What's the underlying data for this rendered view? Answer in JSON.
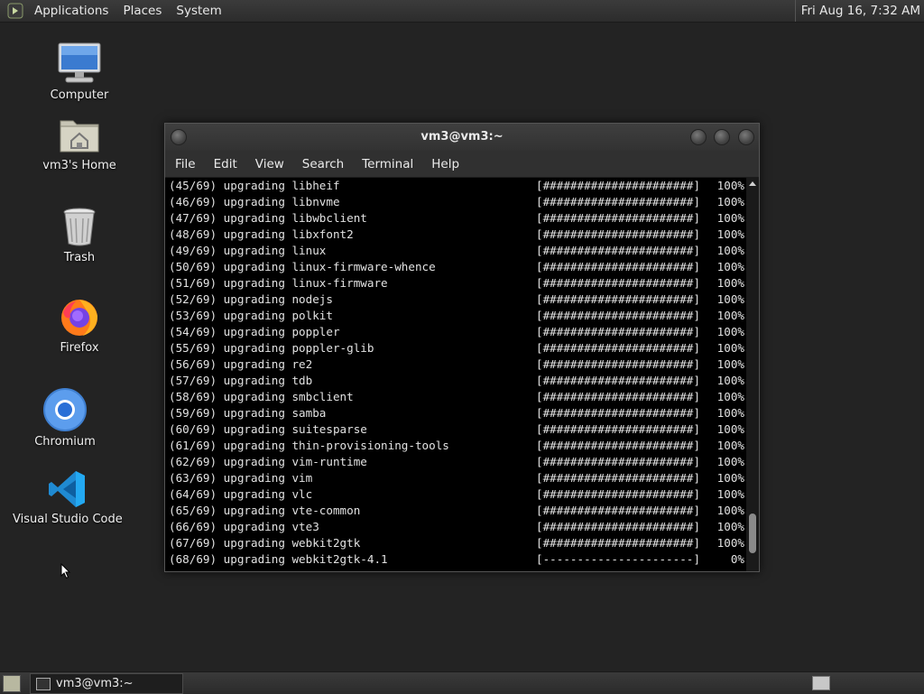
{
  "top_panel": {
    "menus": [
      "Applications",
      "Places",
      "System"
    ],
    "clock": "Fri Aug 16, 7:32 AM"
  },
  "desktop": {
    "icons": [
      {
        "label": "Computer",
        "icon": "computer-icon"
      },
      {
        "label": "vm3's Home",
        "icon": "home-folder-icon"
      },
      {
        "label": "Trash",
        "icon": "trash-icon"
      },
      {
        "label": "Firefox",
        "icon": "firefox-icon"
      },
      {
        "label": "Chromium",
        "icon": "chromium-icon"
      },
      {
        "label": "Visual Studio Code",
        "icon": "vscode-icon"
      }
    ]
  },
  "window": {
    "title": "vm3@vm3:~",
    "menus": [
      "File",
      "Edit",
      "View",
      "Search",
      "Terminal",
      "Help"
    ],
    "lines": [
      {
        "text": "(45/69) upgrading libheif",
        "bar": "[######################]",
        "pct": "100%"
      },
      {
        "text": "(46/69) upgrading libnvme",
        "bar": "[######################]",
        "pct": "100%"
      },
      {
        "text": "(47/69) upgrading libwbclient",
        "bar": "[######################]",
        "pct": "100%"
      },
      {
        "text": "(48/69) upgrading libxfont2",
        "bar": "[######################]",
        "pct": "100%"
      },
      {
        "text": "(49/69) upgrading linux",
        "bar": "[######################]",
        "pct": "100%"
      },
      {
        "text": "(50/69) upgrading linux-firmware-whence",
        "bar": "[######################]",
        "pct": "100%"
      },
      {
        "text": "(51/69) upgrading linux-firmware",
        "bar": "[######################]",
        "pct": "100%"
      },
      {
        "text": "(52/69) upgrading nodejs",
        "bar": "[######################]",
        "pct": "100%"
      },
      {
        "text": "(53/69) upgrading polkit",
        "bar": "[######################]",
        "pct": "100%"
      },
      {
        "text": "(54/69) upgrading poppler",
        "bar": "[######################]",
        "pct": "100%"
      },
      {
        "text": "(55/69) upgrading poppler-glib",
        "bar": "[######################]",
        "pct": "100%"
      },
      {
        "text": "(56/69) upgrading re2",
        "bar": "[######################]",
        "pct": "100%"
      },
      {
        "text": "(57/69) upgrading tdb",
        "bar": "[######################]",
        "pct": "100%"
      },
      {
        "text": "(58/69) upgrading smbclient",
        "bar": "[######################]",
        "pct": "100%"
      },
      {
        "text": "(59/69) upgrading samba",
        "bar": "[######################]",
        "pct": "100%"
      },
      {
        "text": "(60/69) upgrading suitesparse",
        "bar": "[######################]",
        "pct": "100%"
      },
      {
        "text": "(61/69) upgrading thin-provisioning-tools",
        "bar": "[######################]",
        "pct": "100%"
      },
      {
        "text": "(62/69) upgrading vim-runtime",
        "bar": "[######################]",
        "pct": "100%"
      },
      {
        "text": "(63/69) upgrading vim",
        "bar": "[######################]",
        "pct": "100%"
      },
      {
        "text": "(64/69) upgrading vlc",
        "bar": "[######################]",
        "pct": "100%"
      },
      {
        "text": "(65/69) upgrading vte-common",
        "bar": "[######################]",
        "pct": "100%"
      },
      {
        "text": "(66/69) upgrading vte3",
        "bar": "[######################]",
        "pct": "100%"
      },
      {
        "text": "(67/69) upgrading webkit2gtk",
        "bar": "[######################]",
        "pct": "100%"
      },
      {
        "text": "(68/69) upgrading webkit2gtk-4.1",
        "bar": "[----------------------]",
        "pct": "0%"
      }
    ]
  },
  "taskbar": {
    "items": [
      {
        "label": "vm3@vm3:~"
      }
    ]
  }
}
